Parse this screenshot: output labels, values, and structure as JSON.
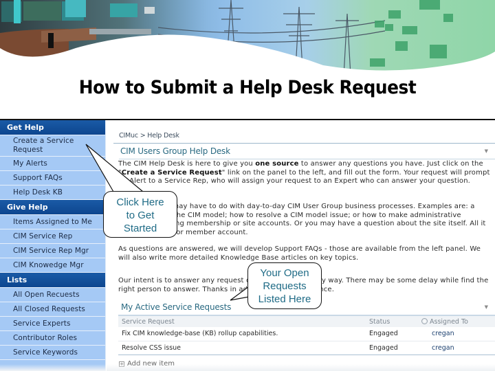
{
  "slide": {
    "title": "How to Submit a Help Desk Request"
  },
  "sidebar": {
    "sections": [
      {
        "header": "Get Help",
        "items": [
          {
            "label": "Create a Service Request",
            "line1": "Create a Service",
            "line2": "Request"
          },
          {
            "label": "My Alerts"
          },
          {
            "label": "Support FAQs"
          },
          {
            "label": "Help Desk KB"
          }
        ]
      },
      {
        "header": "Give Help",
        "items": [
          {
            "label": "Items Assigned to Me"
          },
          {
            "label": "CIM Service Rep"
          },
          {
            "label": "CIM Service Rep Mgr"
          },
          {
            "label": "CIM Knowedge Mgr"
          }
        ]
      },
      {
        "header": "Lists",
        "items": [
          {
            "label": "All Open Recuests"
          },
          {
            "label": "All Closed Requests"
          },
          {
            "label": "Service Experts"
          },
          {
            "label": "Contributor Roles"
          },
          {
            "label": "Service Keywords"
          }
        ]
      }
    ]
  },
  "main": {
    "breadcrumb": "CIMuc > Help Desk",
    "section_title": "CIM Users Group Help Desk",
    "paragraphs": {
      "p1_a": "The CIM Help Desk is here to give you ",
      "p1_bold1": "one source",
      "p1_b": " to answer any questions you have. Just click on the \"",
      "p1_bold2": "Create a Service Request",
      "p1_c": "\" link on the panel to the left, and fill out the form. Your request will prompt an Alert to a Service Rep, who will assign your request to an Expert who can answer your question.",
      "p2": "Your questions may have to do with day-to-day CIM User Group business processes. Examples are: a question about the CIM model; how to resolve a CIM model issue; or how to make administrative changes regarding membership or site accounts. Or you may have a question about the site itself. All it takes is a guest or member account.",
      "p3": "As questions are answered, we will develop Support FAQs - those are available from the left panel. We will also write more detailed Knowledge Base articles on key topics.",
      "p4": "Our intent is to answer any request or question in a timely way. There may be some delay while find the right person to answer. Thanks in advance for your patience."
    },
    "requests": {
      "title": "My Active Service Requests",
      "columns": [
        "Service Request",
        "Status",
        "Assigned To"
      ],
      "rows": [
        {
          "request": "Fix CIM knowledge-base (KB) rollup capabilities.",
          "status": "Engaged",
          "assigned_to": "cregan"
        },
        {
          "request": "Resolve CSS issue",
          "status": "Engaged",
          "assigned_to": "cregan"
        }
      ],
      "add_item": "Add new item"
    }
  },
  "callouts": {
    "click_here": {
      "line1": "Click Here",
      "line2": "to Get",
      "line3": "Started"
    },
    "open_requests": {
      "line1": "Your Open",
      "line2": "Requests",
      "line3": "Listed Here"
    }
  },
  "colors": {
    "sidebar_header": "#0d468f",
    "sidebar_bg": "#a5c9f5",
    "section_title": "#2a6a82",
    "callout_text": "#1f6b86"
  }
}
